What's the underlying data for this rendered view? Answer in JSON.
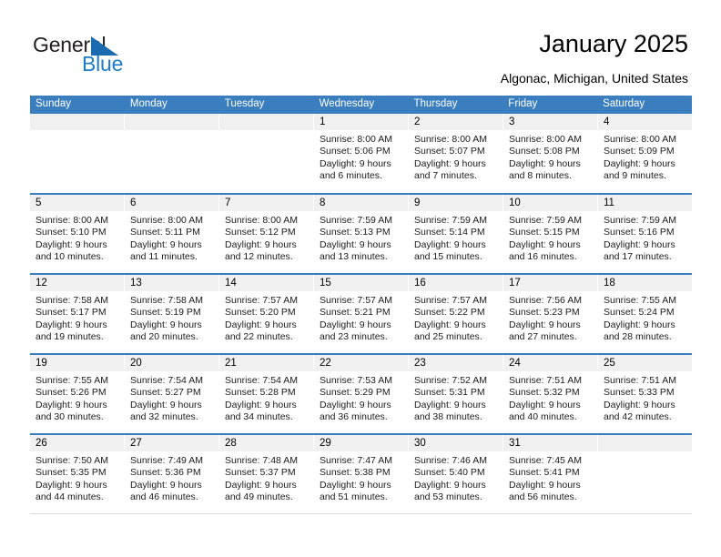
{
  "brand": {
    "name_top": "General",
    "name_bottom": "Blue",
    "accent_color": "#1e7bc8"
  },
  "header": {
    "title": "January 2025",
    "subtitle": "Algonac, Michigan, United States",
    "header_bg": "#3a7ebf",
    "daynum_bg": "#f0f0f0"
  },
  "weekdays": [
    "Sunday",
    "Monday",
    "Tuesday",
    "Wednesday",
    "Thursday",
    "Friday",
    "Saturday"
  ],
  "weeks": [
    [
      {
        "day": "",
        "empty": true
      },
      {
        "day": "",
        "empty": true
      },
      {
        "day": "",
        "empty": true
      },
      {
        "day": "1",
        "sunrise": "Sunrise: 8:00 AM",
        "sunset": "Sunset: 5:06 PM",
        "daylight": "Daylight: 9 hours and 6 minutes."
      },
      {
        "day": "2",
        "sunrise": "Sunrise: 8:00 AM",
        "sunset": "Sunset: 5:07 PM",
        "daylight": "Daylight: 9 hours and 7 minutes."
      },
      {
        "day": "3",
        "sunrise": "Sunrise: 8:00 AM",
        "sunset": "Sunset: 5:08 PM",
        "daylight": "Daylight: 9 hours and 8 minutes."
      },
      {
        "day": "4",
        "sunrise": "Sunrise: 8:00 AM",
        "sunset": "Sunset: 5:09 PM",
        "daylight": "Daylight: 9 hours and 9 minutes."
      }
    ],
    [
      {
        "day": "5",
        "sunrise": "Sunrise: 8:00 AM",
        "sunset": "Sunset: 5:10 PM",
        "daylight": "Daylight: 9 hours and 10 minutes."
      },
      {
        "day": "6",
        "sunrise": "Sunrise: 8:00 AM",
        "sunset": "Sunset: 5:11 PM",
        "daylight": "Daylight: 9 hours and 11 minutes."
      },
      {
        "day": "7",
        "sunrise": "Sunrise: 8:00 AM",
        "sunset": "Sunset: 5:12 PM",
        "daylight": "Daylight: 9 hours and 12 minutes."
      },
      {
        "day": "8",
        "sunrise": "Sunrise: 7:59 AM",
        "sunset": "Sunset: 5:13 PM",
        "daylight": "Daylight: 9 hours and 13 minutes."
      },
      {
        "day": "9",
        "sunrise": "Sunrise: 7:59 AM",
        "sunset": "Sunset: 5:14 PM",
        "daylight": "Daylight: 9 hours and 15 minutes."
      },
      {
        "day": "10",
        "sunrise": "Sunrise: 7:59 AM",
        "sunset": "Sunset: 5:15 PM",
        "daylight": "Daylight: 9 hours and 16 minutes."
      },
      {
        "day": "11",
        "sunrise": "Sunrise: 7:59 AM",
        "sunset": "Sunset: 5:16 PM",
        "daylight": "Daylight: 9 hours and 17 minutes."
      }
    ],
    [
      {
        "day": "12",
        "sunrise": "Sunrise: 7:58 AM",
        "sunset": "Sunset: 5:17 PM",
        "daylight": "Daylight: 9 hours and 19 minutes."
      },
      {
        "day": "13",
        "sunrise": "Sunrise: 7:58 AM",
        "sunset": "Sunset: 5:19 PM",
        "daylight": "Daylight: 9 hours and 20 minutes."
      },
      {
        "day": "14",
        "sunrise": "Sunrise: 7:57 AM",
        "sunset": "Sunset: 5:20 PM",
        "daylight": "Daylight: 9 hours and 22 minutes."
      },
      {
        "day": "15",
        "sunrise": "Sunrise: 7:57 AM",
        "sunset": "Sunset: 5:21 PM",
        "daylight": "Daylight: 9 hours and 23 minutes."
      },
      {
        "day": "16",
        "sunrise": "Sunrise: 7:57 AM",
        "sunset": "Sunset: 5:22 PM",
        "daylight": "Daylight: 9 hours and 25 minutes."
      },
      {
        "day": "17",
        "sunrise": "Sunrise: 7:56 AM",
        "sunset": "Sunset: 5:23 PM",
        "daylight": "Daylight: 9 hours and 27 minutes."
      },
      {
        "day": "18",
        "sunrise": "Sunrise: 7:55 AM",
        "sunset": "Sunset: 5:24 PM",
        "daylight": "Daylight: 9 hours and 28 minutes."
      }
    ],
    [
      {
        "day": "19",
        "sunrise": "Sunrise: 7:55 AM",
        "sunset": "Sunset: 5:26 PM",
        "daylight": "Daylight: 9 hours and 30 minutes."
      },
      {
        "day": "20",
        "sunrise": "Sunrise: 7:54 AM",
        "sunset": "Sunset: 5:27 PM",
        "daylight": "Daylight: 9 hours and 32 minutes."
      },
      {
        "day": "21",
        "sunrise": "Sunrise: 7:54 AM",
        "sunset": "Sunset: 5:28 PM",
        "daylight": "Daylight: 9 hours and 34 minutes."
      },
      {
        "day": "22",
        "sunrise": "Sunrise: 7:53 AM",
        "sunset": "Sunset: 5:29 PM",
        "daylight": "Daylight: 9 hours and 36 minutes."
      },
      {
        "day": "23",
        "sunrise": "Sunrise: 7:52 AM",
        "sunset": "Sunset: 5:31 PM",
        "daylight": "Daylight: 9 hours and 38 minutes."
      },
      {
        "day": "24",
        "sunrise": "Sunrise: 7:51 AM",
        "sunset": "Sunset: 5:32 PM",
        "daylight": "Daylight: 9 hours and 40 minutes."
      },
      {
        "day": "25",
        "sunrise": "Sunrise: 7:51 AM",
        "sunset": "Sunset: 5:33 PM",
        "daylight": "Daylight: 9 hours and 42 minutes."
      }
    ],
    [
      {
        "day": "26",
        "sunrise": "Sunrise: 7:50 AM",
        "sunset": "Sunset: 5:35 PM",
        "daylight": "Daylight: 9 hours and 44 minutes."
      },
      {
        "day": "27",
        "sunrise": "Sunrise: 7:49 AM",
        "sunset": "Sunset: 5:36 PM",
        "daylight": "Daylight: 9 hours and 46 minutes."
      },
      {
        "day": "28",
        "sunrise": "Sunrise: 7:48 AM",
        "sunset": "Sunset: 5:37 PM",
        "daylight": "Daylight: 9 hours and 49 minutes."
      },
      {
        "day": "29",
        "sunrise": "Sunrise: 7:47 AM",
        "sunset": "Sunset: 5:38 PM",
        "daylight": "Daylight: 9 hours and 51 minutes."
      },
      {
        "day": "30",
        "sunrise": "Sunrise: 7:46 AM",
        "sunset": "Sunset: 5:40 PM",
        "daylight": "Daylight: 9 hours and 53 minutes."
      },
      {
        "day": "31",
        "sunrise": "Sunrise: 7:45 AM",
        "sunset": "Sunset: 5:41 PM",
        "daylight": "Daylight: 9 hours and 56 minutes."
      },
      {
        "day": "",
        "empty": true
      }
    ]
  ]
}
